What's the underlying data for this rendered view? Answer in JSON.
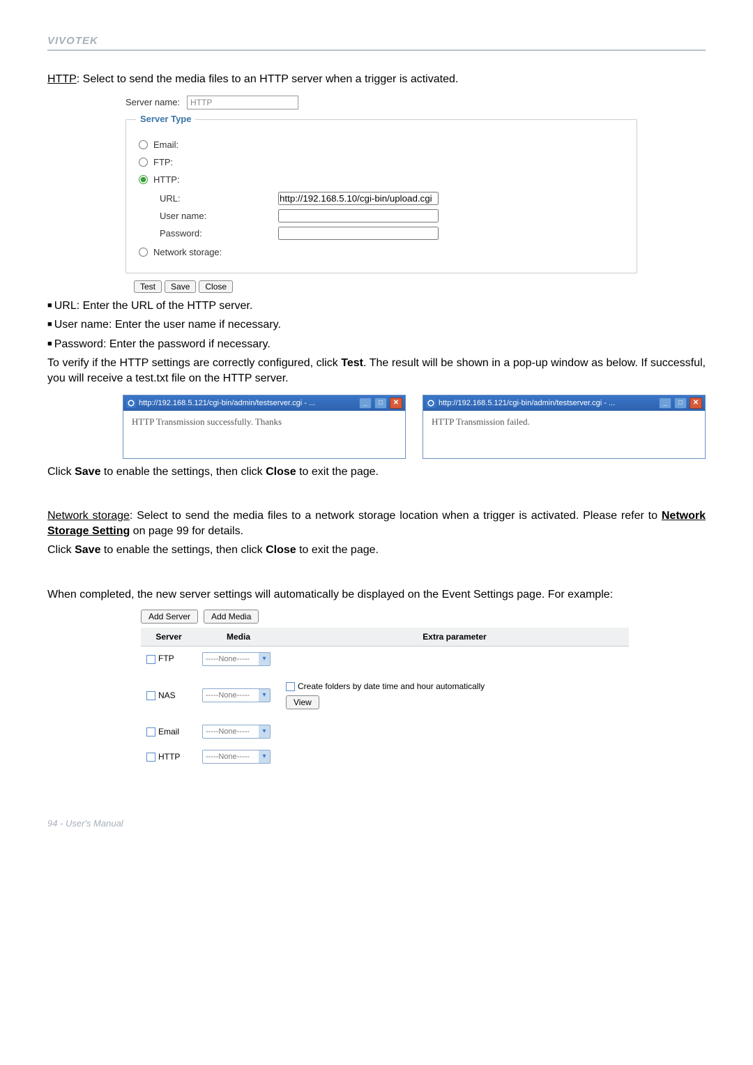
{
  "brand": "VIVOTEK",
  "intro_http": "HTTP",
  "intro_rest": ": Select to send the media files to an HTTP server when a trigger is activated.",
  "form": {
    "server_name_label": "Server name:",
    "server_name_value": "HTTP",
    "server_type_legend": "Server Type",
    "email": "Email:",
    "ftp": "FTP:",
    "http": "HTTP:",
    "url_label": "URL:",
    "url_value": "http://192.168.5.10/cgi-bin/upload.cgi",
    "username_label": "User name:",
    "password_label": "Password:",
    "network_storage": "Network storage:",
    "test": "Test",
    "save": "Save",
    "close": "Close"
  },
  "bullets": {
    "url": "URL: Enter the URL of the HTTP server.",
    "username": "User name: Enter the user name if necessary.",
    "password": "Password: Enter the password if necessary."
  },
  "verify_text_1": "To verify if the HTTP settings are correctly configured, click ",
  "verify_text_bold": "Test",
  "verify_text_2": ". The result will be shown in a pop-up window as below. If successful, you will receive a test.txt file on the HTTP server.",
  "popup": {
    "url": "http://192.168.5.121/cgi-bin/admin/testserver.cgi - ...",
    "success": "HTTP Transmission successfully. Thanks",
    "failed": "HTTP Transmission failed."
  },
  "save_close_text_1": "Click ",
  "save_bold": "Save",
  "save_close_text_2": " to enable the settings, then click ",
  "close_bold": "Close",
  "save_close_text_3": " to exit the page.",
  "ns_under": "Network storage",
  "ns_text_1": ": Select to send the media files to a network storage location when a trigger is activated. Please refer to ",
  "ns_bold": "Network Storage Setting",
  "ns_text_2": " on page 99 for details.",
  "completed_text": "When completed, the new server settings will automatically be displayed on the Event Settings page. For example:",
  "servers": {
    "add_server": "Add Server",
    "add_media": "Add Media",
    "th_server": "Server",
    "th_media": "Media",
    "th_extra": "Extra parameter",
    "none": "-----None-----",
    "row1": "FTP",
    "row2": "NAS",
    "row2_extra": "Create folders by date time and hour automatically",
    "view": "View",
    "row3": "Email",
    "row4": "HTTP"
  },
  "footer": "94 - User's Manual"
}
